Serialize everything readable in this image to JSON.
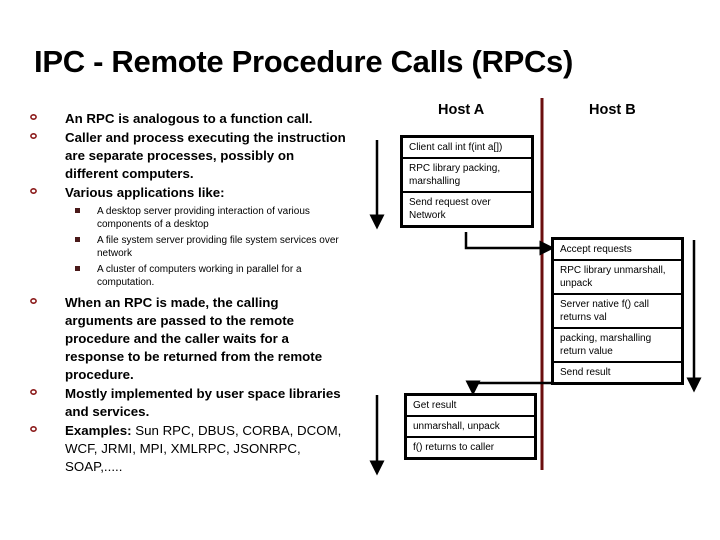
{
  "title": "IPC -  Remote Procedure Calls (RPCs)",
  "colors": {
    "divider": "#6b0f0f",
    "bullet": "#8b1a1a",
    "text": "#000000"
  },
  "bullets": [
    {
      "text": "An RPC is analogous to a function call."
    },
    {
      "text": "Caller and process executing the instruction are separate processes, possibly on different computers."
    },
    {
      "text": "Various applications like:",
      "sub": [
        "A desktop server providing interaction of various components of a desktop",
        "A file system server providing file system services over network",
        "A cluster of computers working in parallel for a computation."
      ]
    },
    {
      "text": "When an RPC is made, the calling arguments are passed to the remote procedure and the caller waits for a response to be returned from the remote procedure."
    },
    {
      "text": "Mostly implemented by user space libraries and services."
    },
    {
      "bold": "Examples:",
      "text": " Sun RPC, DBUS, CORBA, DCOM, WCF, JRMI, MPI, XMLRPC, JSONRPC, SOAP,....."
    }
  ],
  "diagram": {
    "host_a_label": "Host A",
    "host_b_label": "Host B",
    "host_a_request_steps": [
      "Client call  int f(int a[])",
      "RPC library packing, marshalling",
      "Send request over Network"
    ],
    "host_b_steps": [
      "Accept requests",
      "RPC library unmarshall, unpack",
      "Server native f() call returns val",
      "packing, marshalling return value",
      "Send result"
    ],
    "host_a_response_steps": [
      "Get result",
      "unmarshall, unpack",
      "f() returns to caller"
    ]
  }
}
